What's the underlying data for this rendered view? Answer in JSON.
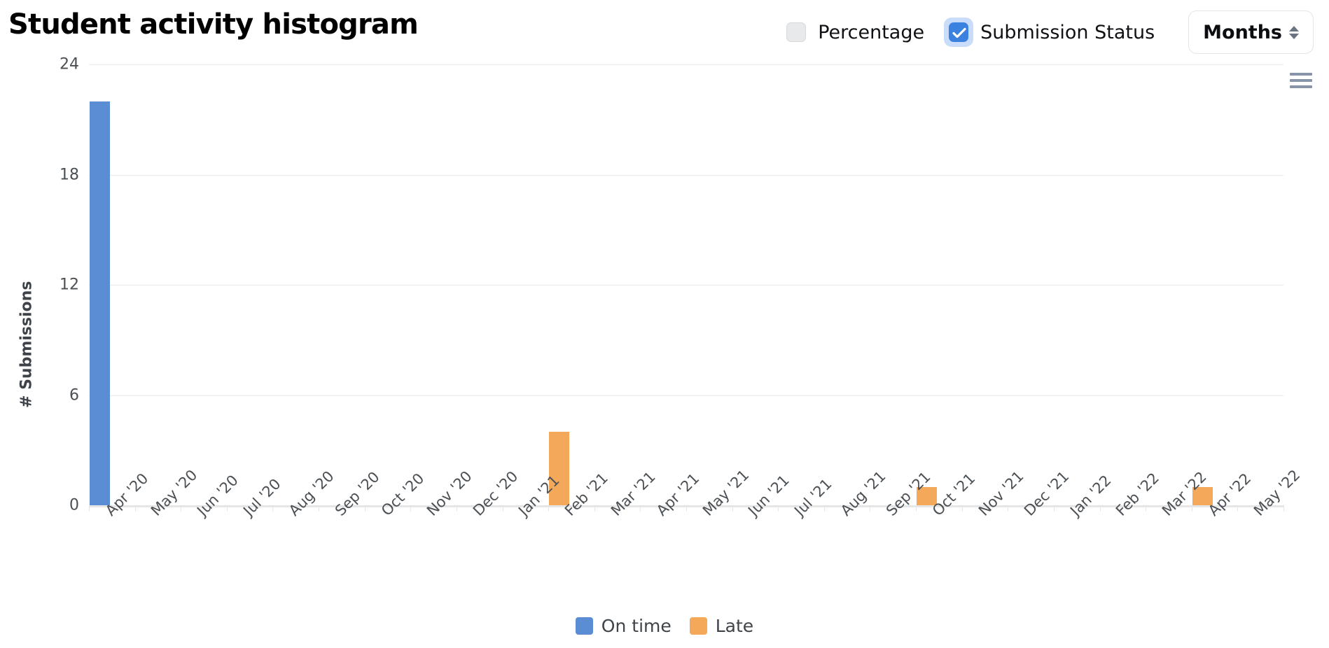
{
  "header": {
    "title": "Student activity histogram",
    "checkboxes": [
      {
        "label": "Percentage",
        "checked": false,
        "name": "percentage"
      },
      {
        "label": "Submission Status",
        "checked": true,
        "name": "submission-status"
      }
    ],
    "dropdown": {
      "label": "Months",
      "icon": "chevron-up-down-icon"
    },
    "export_menu_icon": "hamburger-menu-icon"
  },
  "colors": {
    "on_time": "#5a8dd4",
    "late": "#f4a95a",
    "gridline": "#eaeaea",
    "axis": "#e6e6e6",
    "accent": "#3b82e0",
    "text": "#4b5055"
  },
  "chart_data": {
    "type": "bar",
    "title": "Student activity histogram",
    "xlabel": "",
    "ylabel": "# Submissions",
    "ylim": [
      0,
      24
    ],
    "yticks": [
      0,
      6,
      12,
      18,
      24
    ],
    "grid": true,
    "legend_position": "bottom",
    "stacked": true,
    "categories": [
      "Apr '20",
      "May '20",
      "Jun '20",
      "Jul '20",
      "Aug '20",
      "Sep '20",
      "Oct '20",
      "Nov '20",
      "Dec '20",
      "Jan '21",
      "Feb '21",
      "Mar '21",
      "Apr '21",
      "May '21",
      "Jun '21",
      "Jul '21",
      "Aug '21",
      "Sep '21",
      "Oct '21",
      "Nov '21",
      "Dec '21",
      "Jan '22",
      "Feb '22",
      "Mar '22",
      "Apr '22",
      "May '22"
    ],
    "series": [
      {
        "name": "On time",
        "color": "#5a8dd4",
        "values": [
          22,
          0,
          0,
          0,
          0,
          0,
          0,
          0,
          0,
          0,
          0,
          0,
          0,
          0,
          0,
          0,
          0,
          0,
          0,
          0,
          0,
          0,
          0,
          0,
          0,
          0
        ]
      },
      {
        "name": "Late",
        "color": "#f4a95a",
        "values": [
          0,
          0,
          0,
          0,
          0,
          0,
          0,
          0,
          0,
          0,
          4,
          0,
          0,
          0,
          0,
          0,
          0,
          0,
          1,
          0,
          0,
          0,
          0,
          0,
          1,
          0
        ]
      }
    ]
  },
  "legend": [
    {
      "label": "On time",
      "color": "#5a8dd4"
    },
    {
      "label": "Late",
      "color": "#f4a95a"
    }
  ]
}
